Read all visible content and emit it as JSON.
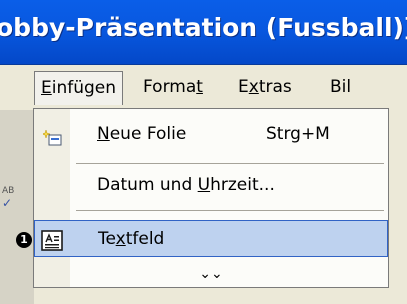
{
  "window": {
    "title": "obby-Präsentation (Fussball)]"
  },
  "menubar": {
    "items": [
      {
        "label": "Einfügen",
        "active": true
      },
      {
        "label": "Format"
      },
      {
        "label": "Extras"
      },
      {
        "label": "Bil"
      }
    ]
  },
  "dropdown": {
    "items": [
      {
        "label": "Neue Folie",
        "shortcut": "Strg+M",
        "icon": "new-slide-icon"
      },
      {
        "label": "Datum und Uhrzeit...",
        "icon": null
      },
      {
        "label": "Textfeld",
        "icon": "textbox-icon",
        "highlighted": true
      }
    ],
    "more_glyph": "⌄⌄",
    "more_icon": "expand-chevrons-icon"
  },
  "background": {
    "ghost_text": "AB",
    "ghost_glyph": "✓"
  },
  "annotation": {
    "badge": "1"
  },
  "colors": {
    "title_blue": "#0858e0",
    "menu_bg": "#ece9d8",
    "highlight_bg": "#bed2ef",
    "highlight_border": "#3163c5"
  }
}
